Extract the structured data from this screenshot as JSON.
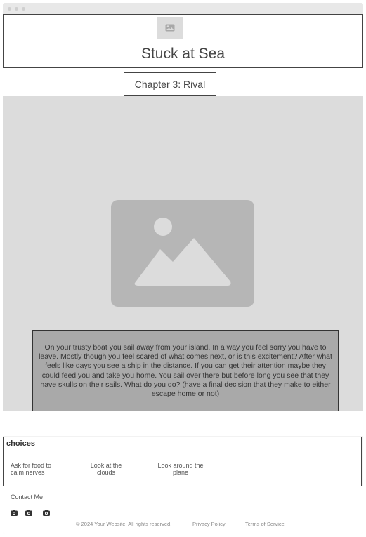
{
  "header": {
    "logo_icon": "image-placeholder-icon",
    "title": "Stuck at Sea"
  },
  "chapter": {
    "label": "Chapter 3: Rival"
  },
  "hero": {
    "image_icon": "image-placeholder-icon"
  },
  "story": {
    "text": "On your trusty boat you sail away from your island. In a way you feel sorry you have to leave. Mostly though you feel scared of what comes next, or is this excitement? After what feels like days you see a ship in the distance. If you can get their attention maybe they could feed you and take you home. You sail over there but before long you see that they have skulls on their sails. What do you do? (have a final decision that they make to either escape home or not)"
  },
  "choices": {
    "heading": "choices",
    "options": [
      {
        "label": "Ask for food to calm nerves"
      },
      {
        "label": "Look at the clouds"
      },
      {
        "label": "Look around the plane"
      }
    ]
  },
  "footer": {
    "contact_label": "Contact Me",
    "social_icons": [
      "camera-icon",
      "camera-icon",
      "camera-icon"
    ],
    "copyright": "© 2024 Your Website. All rights reserved.",
    "links": [
      {
        "label": "Privacy Policy"
      },
      {
        "label": "Terms of Service"
      }
    ]
  },
  "colors": {
    "page_bg": "#f2f2f2",
    "hero_bg": "#dcdcdc",
    "story_bg": "#a9a9a9",
    "placeholder": "#b6b6b6",
    "border": "#444444"
  }
}
